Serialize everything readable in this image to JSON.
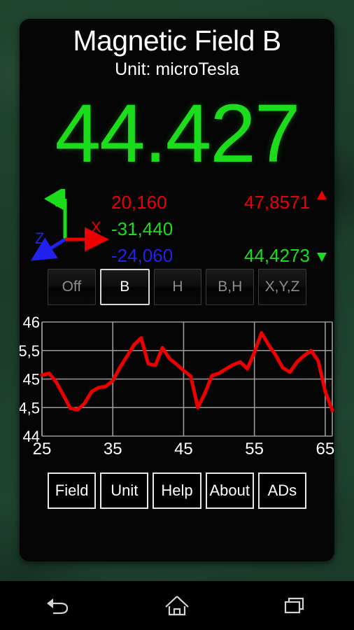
{
  "app": {
    "title": "Magnetic Field B",
    "unit_line": "Unit: microTesla",
    "main_value": "44.427"
  },
  "colors": {
    "x_axis": "#ee0000",
    "y_axis": "#1cdd1c",
    "z_axis": "#2222ee",
    "value_green": "#1cdd1c",
    "max_red": "#ee0000",
    "card_bg": "#050505",
    "desktop_bg": "#1d4030",
    "curve": "#ee0000"
  },
  "vector": {
    "axis_labels": {
      "x": "X",
      "y": "Y",
      "z": "Z"
    },
    "components": {
      "x_value": "20,160",
      "y_value": "-31,440",
      "z_value": "-24,060"
    },
    "magnitude": {
      "max_value": "47,8571",
      "current_value": "44,4273",
      "arrow_icon": "double-arrow-vertical"
    }
  },
  "mode_buttons": [
    {
      "label": "Off",
      "selected": false
    },
    {
      "label": "B",
      "selected": true
    },
    {
      "label": "H",
      "selected": false
    },
    {
      "label": "B,H",
      "selected": false
    },
    {
      "label": "X,Y,Z",
      "selected": false
    }
  ],
  "action_buttons": [
    {
      "label": "Field"
    },
    {
      "label": "Unit"
    },
    {
      "label": "Help"
    },
    {
      "label": "About"
    },
    {
      "label": "ADs"
    }
  ],
  "chart_data": {
    "type": "line",
    "title": "",
    "xlabel": "",
    "ylabel": "",
    "xlim": [
      25,
      66
    ],
    "ylim": [
      44,
      46
    ],
    "grid": true,
    "legend": false,
    "y_tick_labels": [
      "46",
      "5,5",
      "45",
      "4,5",
      "44"
    ],
    "y_tick_values": [
      46,
      45.5,
      45,
      44.5,
      44
    ],
    "x_tick_labels": [
      "25",
      "35",
      "45",
      "55",
      "65"
    ],
    "x_tick_values": [
      25,
      35,
      45,
      55,
      65
    ],
    "series": [
      {
        "name": "B",
        "color": "#ee0000",
        "x": [
          25,
          26,
          27,
          28,
          29,
          30,
          31,
          32,
          33,
          34,
          35,
          36,
          37,
          38,
          39,
          40,
          41,
          42,
          43,
          44,
          45,
          46,
          47,
          48,
          49,
          50,
          51,
          52,
          53,
          54,
          55,
          56,
          57,
          58,
          59,
          60,
          61,
          62,
          63,
          64,
          65,
          66
        ],
        "y": [
          45.07,
          45.1,
          44.95,
          44.72,
          44.49,
          44.46,
          44.57,
          44.78,
          44.85,
          44.87,
          44.97,
          45.2,
          45.4,
          45.6,
          45.72,
          45.27,
          45.24,
          45.55,
          45.36,
          45.26,
          45.15,
          45.05,
          44.5,
          44.75,
          45.06,
          45.1,
          45.18,
          45.25,
          45.3,
          45.18,
          45.47,
          45.81,
          45.6,
          45.42,
          45.2,
          45.12,
          45.3,
          45.41,
          45.5,
          45.32,
          44.78,
          44.45
        ]
      }
    ]
  },
  "nav_bar": {
    "back": "back-icon",
    "home": "home-icon",
    "recents": "recents-icon"
  }
}
